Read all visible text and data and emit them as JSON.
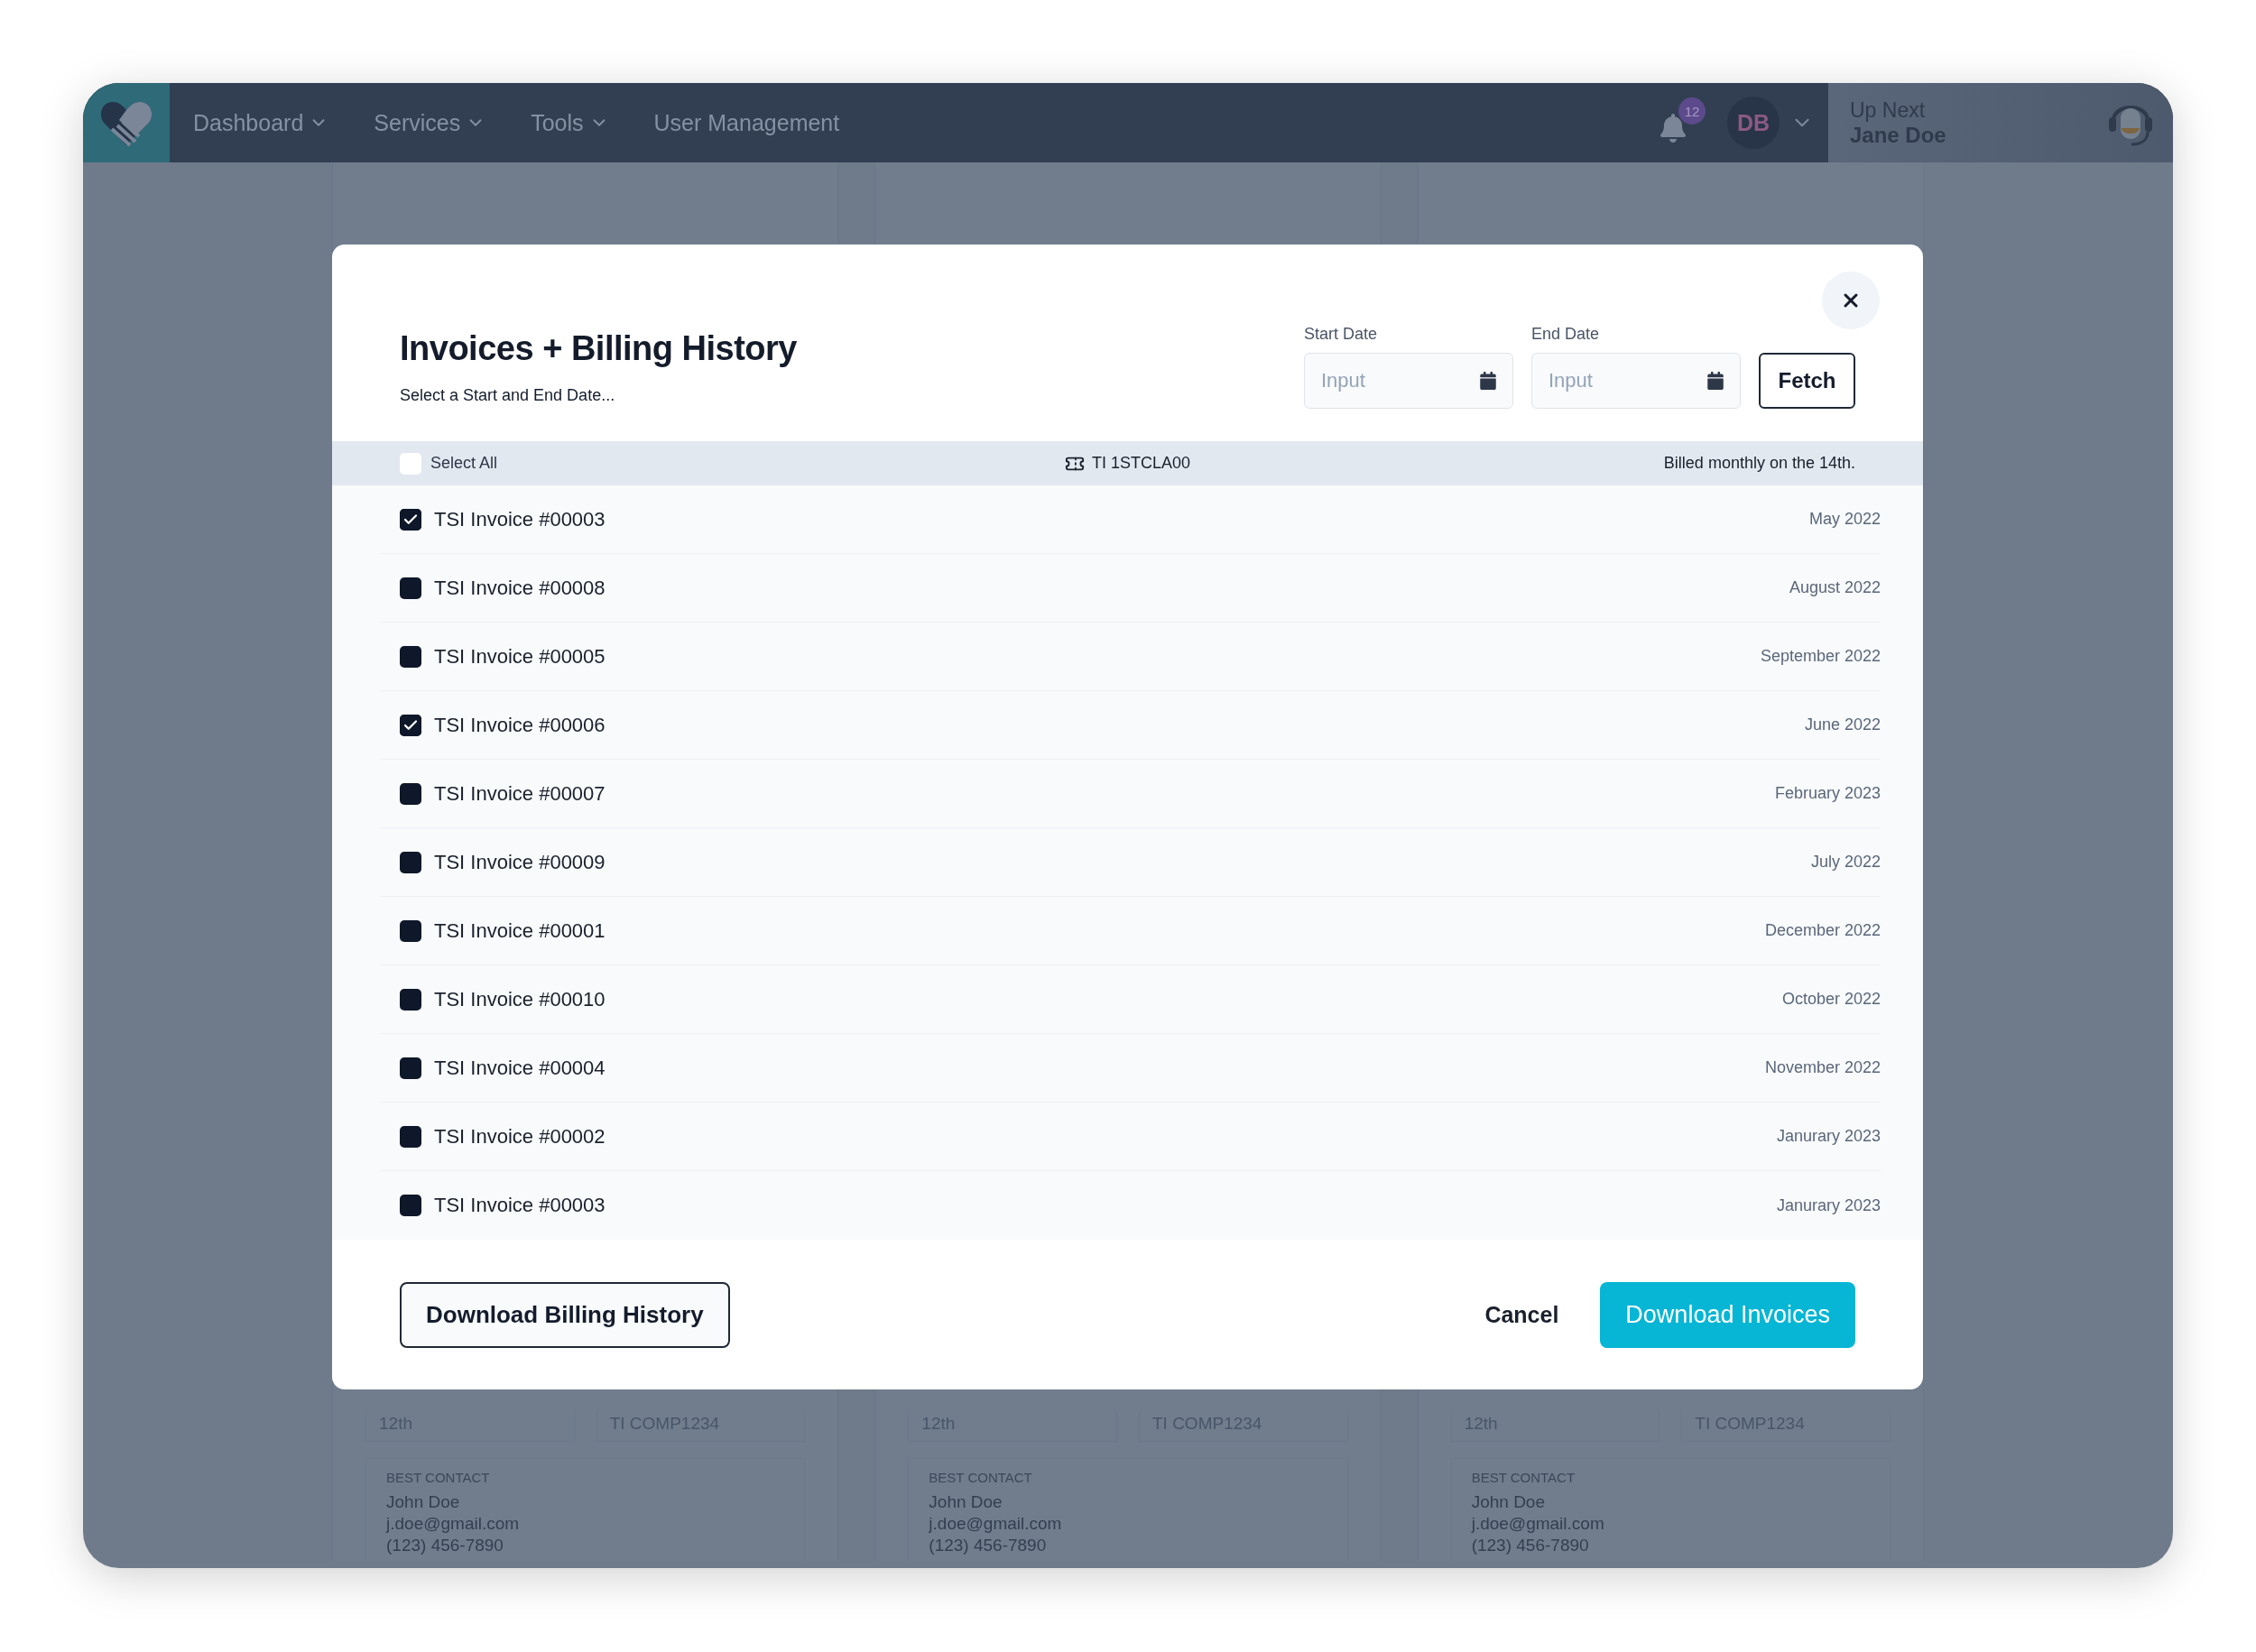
{
  "nav": {
    "items": [
      {
        "label": "Dashboard",
        "has_menu": true
      },
      {
        "label": "Services",
        "has_menu": true
      },
      {
        "label": "Tools",
        "has_menu": true
      },
      {
        "label": "User Management",
        "has_menu": false
      }
    ],
    "notifications": "12",
    "avatar": "DB",
    "up_next": {
      "label": "Up Next",
      "name": "Jane Doe"
    }
  },
  "modal": {
    "title": "Invoices + Billing History",
    "subtitle": "Select a Start and End Date...",
    "start_date": {
      "label": "Start Date",
      "placeholder": "Input"
    },
    "end_date": {
      "label": "End Date",
      "placeholder": "Input"
    },
    "fetch": "Fetch",
    "select_all": {
      "label": "Select All",
      "checked": false
    },
    "account": "TI 1STCLA00",
    "billing_note": "Billed monthly on the 14th.",
    "invoices": [
      {
        "name": "TSI Invoice #00003",
        "date": "May 2022",
        "checked": true
      },
      {
        "name": "TSI Invoice #00008",
        "date": "August 2022",
        "checked": false
      },
      {
        "name": "TSI Invoice #00005",
        "date": "September 2022",
        "checked": false
      },
      {
        "name": "TSI Invoice #00006",
        "date": "June 2022",
        "checked": true
      },
      {
        "name": "TSI Invoice #00007",
        "date": "February 2023",
        "checked": false
      },
      {
        "name": "TSI Invoice #00009",
        "date": "July 2022",
        "checked": false
      },
      {
        "name": "TSI Invoice #00001",
        "date": "December 2022",
        "checked": false
      },
      {
        "name": "TSI Invoice #00010",
        "date": "October 2022",
        "checked": false
      },
      {
        "name": "TSI Invoice #00004",
        "date": "November 2022",
        "checked": false
      },
      {
        "name": "TSI Invoice #00002",
        "date": "Janurary 2023",
        "checked": false
      },
      {
        "name": "TSI Invoice #00003",
        "date": "Janurary 2023",
        "checked": false
      }
    ],
    "buttons": {
      "download_history": "Download Billing History",
      "cancel": "Cancel",
      "download_invoices": "Download Invoices"
    }
  },
  "background_cards": [
    {
      "cell_1": "12th",
      "cell_2": "TI COMP1234",
      "contact_label": "BEST CONTACT",
      "contact_name": "John Doe",
      "email": "j.doe@gmail.com",
      "phone": "(123) 456-7890"
    },
    {
      "cell_1": "12th",
      "cell_2": "TI COMP1234",
      "contact_label": "BEST CONTACT",
      "contact_name": "John Doe",
      "email": "j.doe@gmail.com",
      "phone": "(123) 456-7890"
    },
    {
      "cell_1": "12th",
      "cell_2": "TI COMP1234",
      "contact_label": "BEST CONTACT",
      "contact_name": "John Doe",
      "email": "j.doe@gmail.com",
      "phone": "(123) 456-7890"
    }
  ]
}
